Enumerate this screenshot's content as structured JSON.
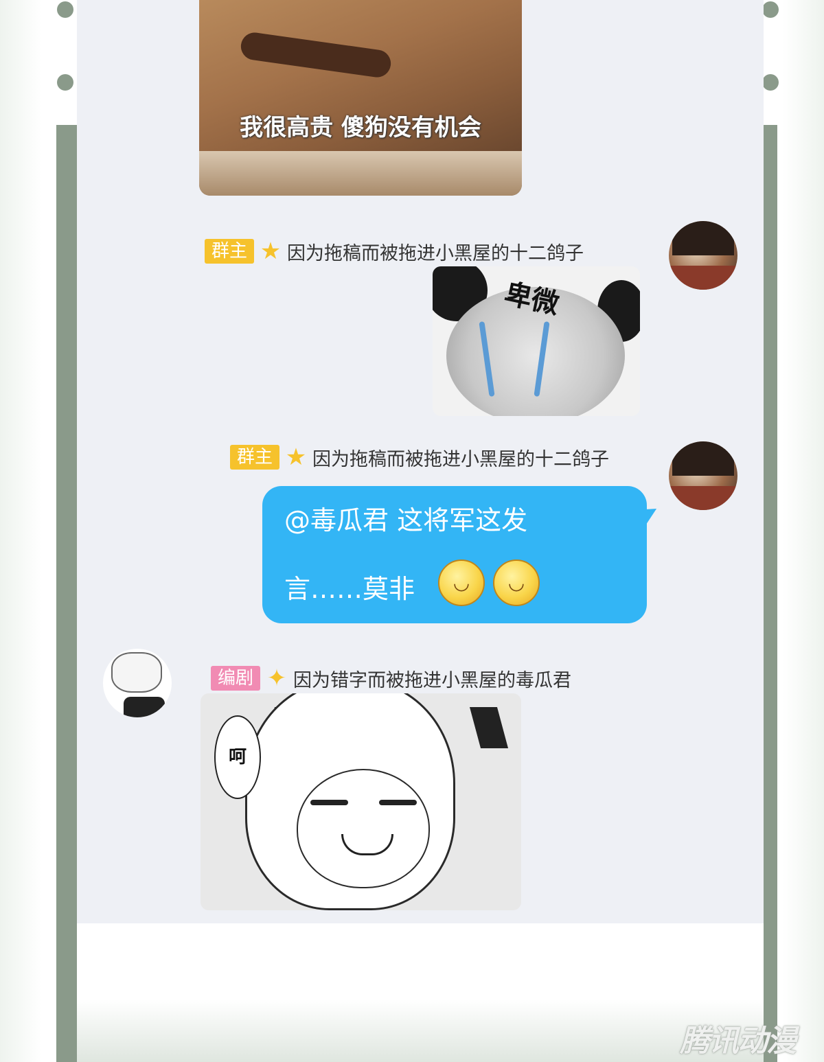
{
  "images": {
    "dog_caption": "我很高贵 傻狗没有机会",
    "panda_text": "卑微",
    "anya_bubble_text": "呵"
  },
  "messages": [
    {
      "badge": "群主",
      "star_icon": "star-icon",
      "sender": "因为拖稿而被拖进小黑屋的十二鸽子",
      "type": "sticker"
    },
    {
      "badge": "群主",
      "star_icon": "star-icon",
      "sender": "因为拖稿而被拖进小黑屋的十二鸽子",
      "type": "text",
      "line1": "@毒瓜君 这将军这发",
      "line2": "言……莫非"
    },
    {
      "badge": "编剧",
      "star_icon": "star-icon",
      "sender": "因为错字而被拖进小黑屋的毒瓜君",
      "type": "sticker"
    }
  ],
  "watermark": "腾讯动漫",
  "colors": {
    "bubble": "#33b5f5",
    "owner_badge": "#f6c22c",
    "editor_badge": "#f18bb3",
    "rail": "#8a9a8a",
    "panel": "#eef0f5"
  }
}
